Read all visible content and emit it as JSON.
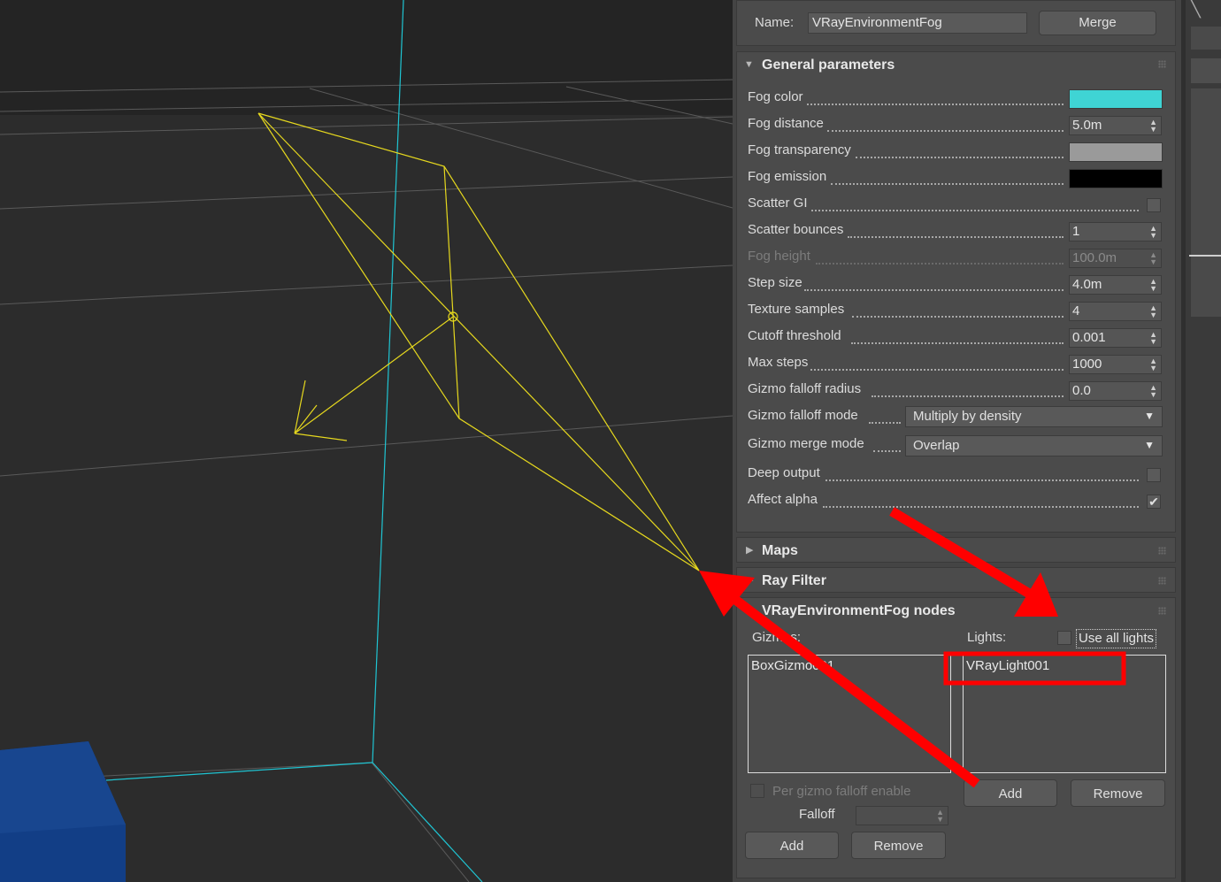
{
  "header": {
    "name_label": "Name:",
    "name_value": "VRayEnvironmentFog",
    "merge_button": "Merge"
  },
  "general": {
    "title": "General parameters",
    "fog_color": {
      "label": "Fog color",
      "color": "#3fd4d4"
    },
    "fog_distance": {
      "label": "Fog distance",
      "value": "5.0m"
    },
    "fog_transparency": {
      "label": "Fog transparency",
      "color": "#9a9a9a"
    },
    "fog_emission": {
      "label": "Fog emission",
      "color": "#000000"
    },
    "scatter_gi": {
      "label": "Scatter GI",
      "checked": false
    },
    "scatter_bounces": {
      "label": "Scatter bounces",
      "value": "1"
    },
    "fog_height": {
      "label": "Fog height",
      "value": "100.0m",
      "disabled": true
    },
    "step_size": {
      "label": "Step size",
      "value": "4.0m"
    },
    "texture_samples": {
      "label": "Texture samples",
      "value": "4"
    },
    "cutoff_threshold": {
      "label": "Cutoff threshold",
      "value": "0.001"
    },
    "max_steps": {
      "label": "Max steps",
      "value": "1000"
    },
    "gizmo_falloff_radius": {
      "label": "Gizmo falloff radius",
      "value": "0.0"
    },
    "gizmo_falloff_mode": {
      "label": "Gizmo falloff mode",
      "value": "Multiply by density"
    },
    "gizmo_merge_mode": {
      "label": "Gizmo merge mode",
      "value": "Overlap"
    },
    "deep_output": {
      "label": "Deep output",
      "checked": false
    },
    "affect_alpha": {
      "label": "Affect alpha",
      "checked": true,
      "check_glyph": "✔"
    }
  },
  "rollouts": {
    "maps": "Maps",
    "ray_filter": "Ray Filter"
  },
  "nodes": {
    "title": "VRayEnvironmentFog nodes",
    "gizmos_label": "Gizmos:",
    "lights_label": "Lights:",
    "use_all_lights": "Use all lights",
    "gizmos": [
      "BoxGizmo001"
    ],
    "lights": [
      "VRayLight001"
    ],
    "lights_add": "Add",
    "lights_remove": "Remove",
    "per_gizmo_falloff": "Per gizmo falloff enable",
    "falloff_label": "Falloff",
    "gizmos_add": "Add",
    "gizmos_remove": "Remove"
  },
  "colors": {
    "annotation": "#ff0000",
    "light_gizmo": "#e6d81e",
    "grid_axis": "#1fc4d2",
    "box_object": "#123e86"
  }
}
